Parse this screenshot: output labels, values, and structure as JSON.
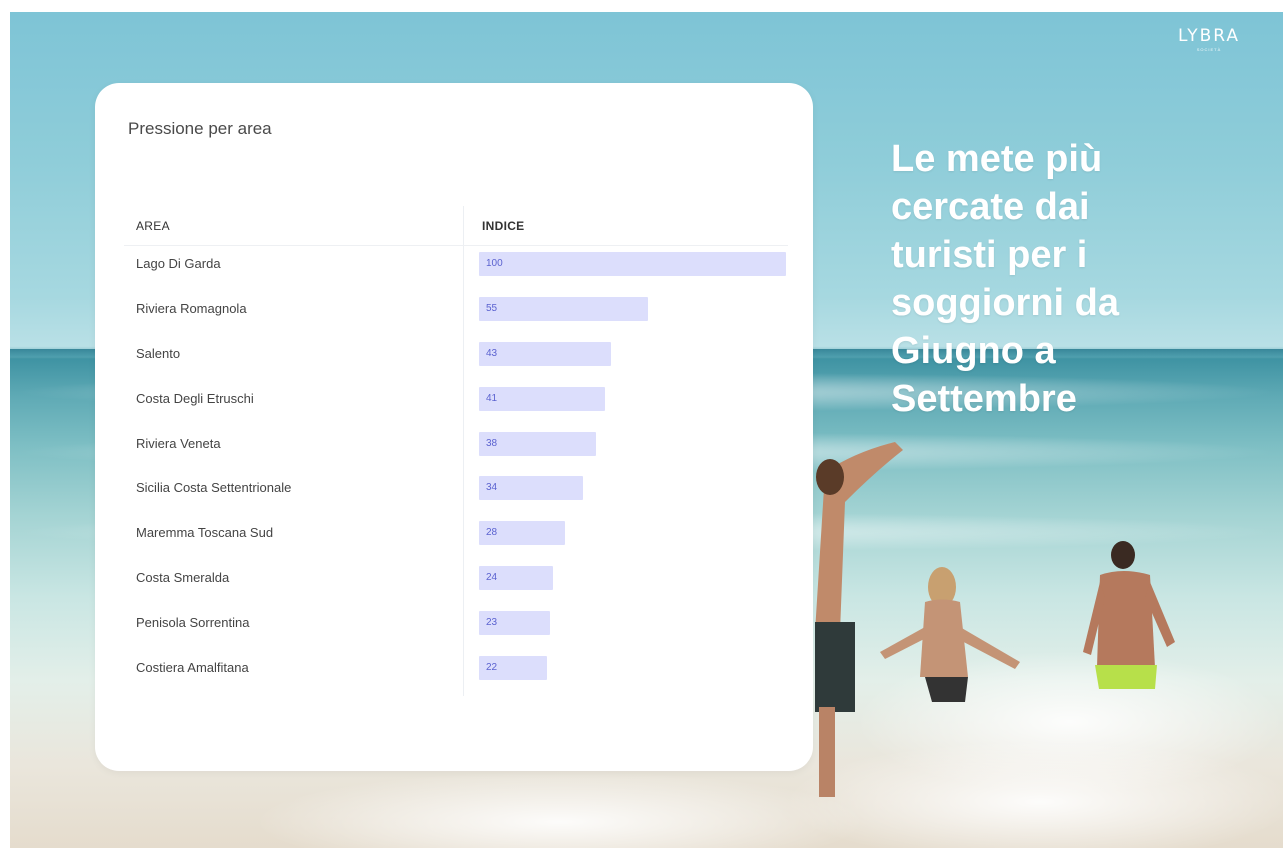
{
  "brand": {
    "logo_text": "LYBRA",
    "logo_subtext": "SOCIETÀ"
  },
  "headline": "Le mete più cercate dai turisti per i soggiorni da Giugno a Settembre",
  "card": {
    "title": "Pressione per area"
  },
  "chart_data": {
    "type": "bar",
    "orientation": "horizontal",
    "title": "Pressione per area",
    "columns": [
      "AREA",
      "INDICE"
    ],
    "categories": [
      "Lago Di Garda",
      "Riviera Romagnola",
      "Salento",
      "Costa Degli Etruschi",
      "Riviera Veneta",
      "Sicilia Costa Settentrionale",
      "Maremma Toscana Sud",
      "Costa Smeralda",
      "Penisola Sorrentina",
      "Costiera Amalfitana"
    ],
    "values": [
      100,
      55,
      43,
      41,
      38,
      34,
      28,
      24,
      23,
      22
    ],
    "xlim": [
      0,
      100
    ],
    "bar_color": "#dcdefc",
    "label_color": "#5b62d0",
    "grid": false,
    "legend": "none"
  },
  "colors": {
    "card_bg": "#ffffff",
    "text": "#444444",
    "headline": "#ffffff"
  }
}
